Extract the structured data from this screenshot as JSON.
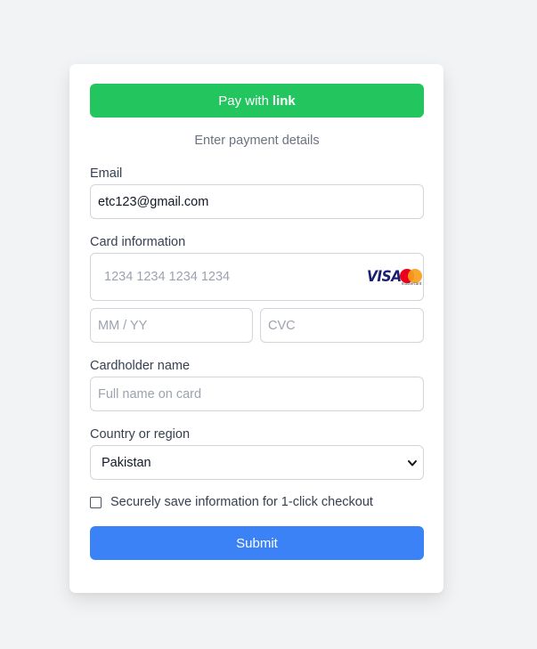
{
  "pay_link": {
    "prefix": "Pay with",
    "brand": "link"
  },
  "subtitle": "Enter payment details",
  "email": {
    "label": "Email",
    "value": "etc123@gmail.com"
  },
  "card_info": {
    "label": "Card information",
    "number_placeholder": "1234 1234 1234 1234",
    "expiry_placeholder": "MM / YY",
    "cvc_placeholder": "CVC",
    "brand_icons": [
      "visa-logo",
      "mastercard-logo"
    ],
    "visa_text": "VISA",
    "mastercard_text": "mastercard"
  },
  "cardholder": {
    "label": "Cardholder name",
    "placeholder": "Full name on card"
  },
  "country": {
    "label": "Country or region",
    "selected": "Pakistan"
  },
  "save_info": {
    "label": "Securely save information for 1-click checkout",
    "checked": false
  },
  "submit_label": "Submit",
  "colors": {
    "link_green": "#22c55e",
    "submit_blue": "#3b82f6",
    "page_bg": "#f2f3f5"
  }
}
